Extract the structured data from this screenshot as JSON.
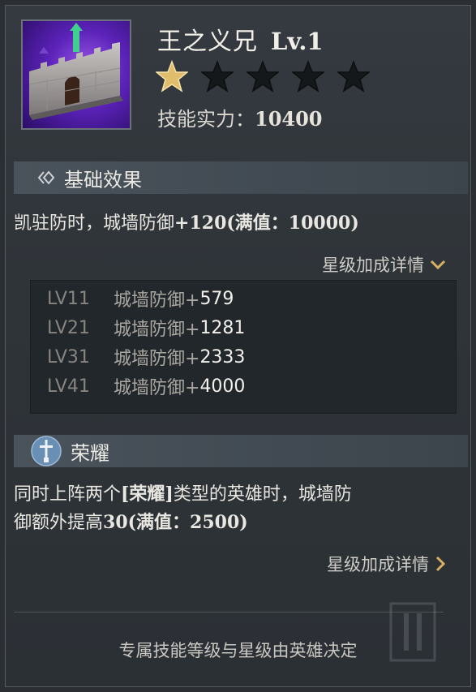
{
  "hero_skill": {
    "name": "王之义兄",
    "level": "Lv.1",
    "stars": {
      "filled": 1,
      "total": 5
    },
    "power_label": "技能实力：",
    "power_value": "10400"
  },
  "basic_effect": {
    "header": "基础效果",
    "desc_prefix": "凯驻防时，城墙防御",
    "desc_value": "+120",
    "desc_max": "(满值：10000)",
    "detail_link": "星级加成详情",
    "detail_icon": "chevron-down-icon",
    "levels": [
      {
        "id": "LV11",
        "label": "城墙防御+",
        "value": "579"
      },
      {
        "id": "LV21",
        "label": "城墙防御+",
        "value": "1281"
      },
      {
        "id": "LV31",
        "label": "城墙防御+",
        "value": "2333"
      },
      {
        "id": "LV41",
        "label": "城墙防御+",
        "value": "4000"
      }
    ]
  },
  "glory": {
    "header": "荣耀",
    "line1_a": "同时上阵两个",
    "line1_tag": "[荣耀]",
    "line1_b": "类型的英雄时，城墙防",
    "line2_a": "御额外提高",
    "line2_value": "30",
    "line2_max": "(满值：2500)",
    "detail_link": "星级加成详情",
    "detail_icon": "chevron-right-icon"
  },
  "footer": {
    "note": "专属技能等级与星级由英雄决定"
  },
  "colors": {
    "accent_gold": "#d8b061",
    "panel": "#22272c",
    "section_bar": "#454e56"
  }
}
